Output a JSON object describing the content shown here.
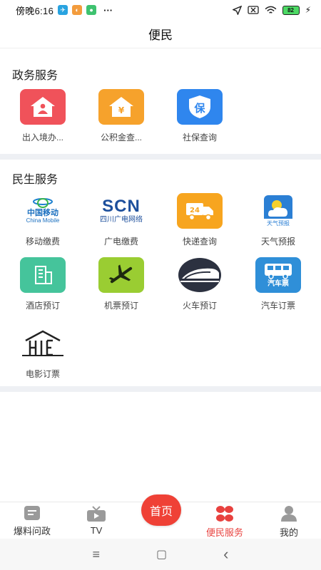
{
  "status_bar": {
    "time": "傍晚6:16",
    "more": "···",
    "battery": "82"
  },
  "header": {
    "title": "便民"
  },
  "gov": {
    "title": "政务服务",
    "items": [
      {
        "label": "出入境办...",
        "icon": "house-person-icon",
        "color": "#f0525a"
      },
      {
        "label": "公积金查...",
        "icon": "house-yen-icon",
        "color": "#f6a22c"
      },
      {
        "label": "社保查询",
        "icon": "shield-bao-icon",
        "color": "#2f86ee",
        "glyph": "保"
      }
    ]
  },
  "life": {
    "title": "民生服务",
    "items": [
      {
        "label": "移动缴费",
        "icon": "china-mobile-logo-icon",
        "logo_text": "中国移动",
        "logo_sub": "China Mobile"
      },
      {
        "label": "广电缴费",
        "icon": "scn-logo-icon",
        "logo_text": "SCN",
        "logo_sub": "四川广电网络"
      },
      {
        "label": "快递查询",
        "icon": "delivery-truck-icon",
        "color": "#f7a51f",
        "glyph": "24"
      },
      {
        "label": "天气预报",
        "icon": "weather-sun-cloud-icon",
        "logo_text": "天气预报"
      },
      {
        "label": "酒店预订",
        "icon": "hotel-building-icon",
        "color": "#45c49b"
      },
      {
        "label": "机票预订",
        "icon": "airplane-icon",
        "color": "#9acd32"
      },
      {
        "label": "火车预订",
        "icon": "train-icon"
      },
      {
        "label": "汽车订票",
        "icon": "bus-ticket-icon",
        "logo_text": "汽车票",
        "color": "#2f8fd8"
      },
      {
        "label": "电影订票",
        "icon": "cinema-house-icon"
      }
    ]
  },
  "tabs": [
    {
      "label": "爆料问政",
      "icon": "report-doc-icon"
    },
    {
      "label": "TV",
      "icon": "tv-icon"
    },
    {
      "label": "便民服务",
      "icon": "services-grid-icon",
      "active": true
    },
    {
      "label": "我的",
      "icon": "user-icon"
    }
  ],
  "home_button": {
    "label": "首页"
  },
  "nav": {
    "menu": "≡",
    "home": "▢",
    "back": "‹"
  },
  "colors": {
    "accent": "#e8413e",
    "divider": "#eef0f4"
  }
}
